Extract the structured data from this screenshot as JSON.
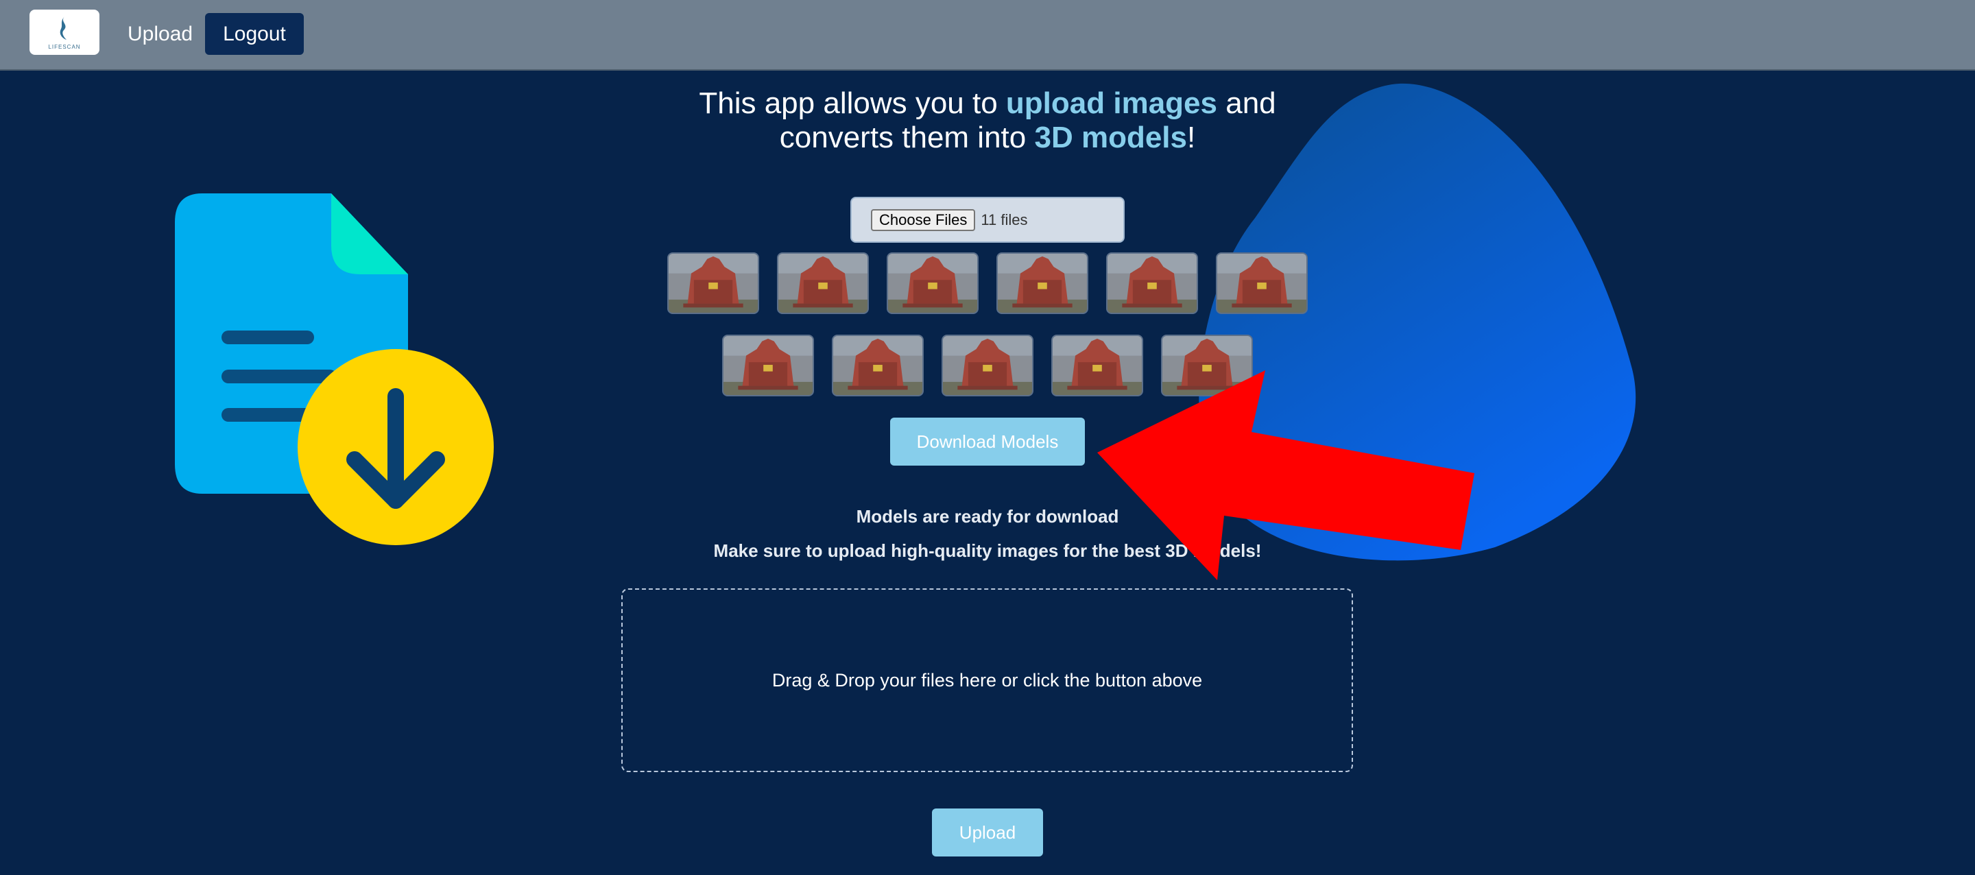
{
  "nav": {
    "logo_text": "LIFESCAN",
    "upload_label": "Upload",
    "logout_label": "Logout"
  },
  "hero": {
    "line1_pre": "This app allows you to ",
    "line1_hl": "upload images",
    "line1_post": " and",
    "line2_pre": "converts them into ",
    "line2_hl": "3D models",
    "line2_post": "!"
  },
  "file_input": {
    "button_label": "Choose Files",
    "status": "11 files"
  },
  "thumbnails": [
    {
      "name": "image-1"
    },
    {
      "name": "image-2"
    },
    {
      "name": "image-3"
    },
    {
      "name": "image-4"
    },
    {
      "name": "image-5"
    },
    {
      "name": "image-6"
    },
    {
      "name": "image-7"
    },
    {
      "name": "image-8"
    },
    {
      "name": "image-9"
    },
    {
      "name": "image-10"
    },
    {
      "name": "image-11"
    }
  ],
  "download_button": "Download Models",
  "status": {
    "ready": "Models are ready for download",
    "tip": "Make sure to upload high-quality images for the best 3D models!"
  },
  "dropzone_text": "Drag & Drop your files here or click the button above",
  "upload_button": "Upload",
  "colors": {
    "background": "#06234a",
    "navbar": "#708090",
    "accent": "#87ceeb",
    "logout_bg": "#0a2a57",
    "annotation_arrow": "#ff0000"
  },
  "icons": [
    "document-download-illustration",
    "red-arrow-annotation",
    "blob-decoration"
  ]
}
